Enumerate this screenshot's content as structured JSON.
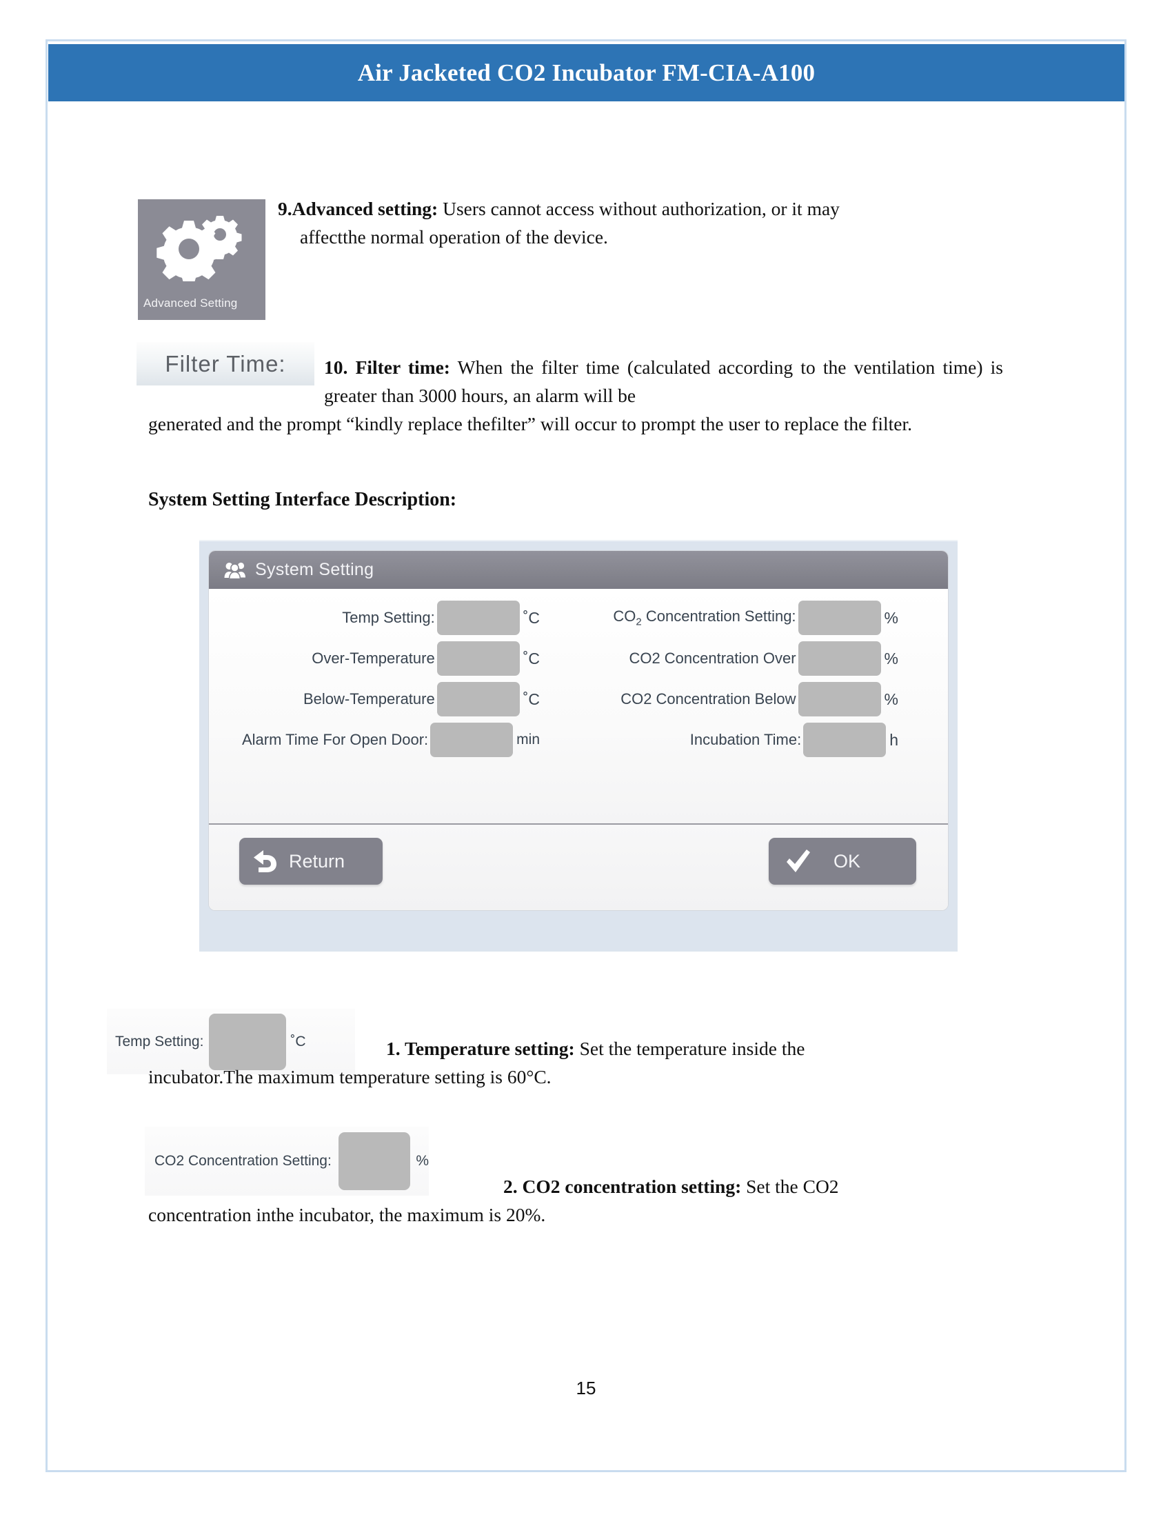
{
  "header": {
    "title": "Air Jacketed CO2 Incubator FM-CIA-A100"
  },
  "advanced_setting": {
    "icon_name": "gears-icon",
    "icon_caption": "Advanced Setting",
    "item_number": "9.",
    "item_title": "Advanced setting:",
    "text_line1": " Users cannot access without authorization, or it may",
    "text_line2": "affectthe normal operation of the device."
  },
  "filter_time": {
    "chip_label": "Filter Time:",
    "item_number": "10. ",
    "item_title": "Filter time:",
    "text_part1": " When the filter time (calculated according to the ventilation time) is greater than 3000 hours, an alarm will be",
    "text_part2": "generated and the prompt “kindly replace thefilter” will occur to prompt the user to replace the filter."
  },
  "section_heading": "System Setting Interface Description:",
  "dialog": {
    "title": "System Setting",
    "title_icon": "users-group-icon",
    "fields": [
      {
        "key": "temp_setting",
        "label": "Temp Setting:",
        "value": "",
        "unit": "˚C"
      },
      {
        "key": "over_temp",
        "label": "Over-Temperature",
        "value": "",
        "unit": "˚C"
      },
      {
        "key": "below_temp",
        "label": "Below-Temperature",
        "value": "",
        "unit": "˚C"
      },
      {
        "key": "alarm_time",
        "label": "Alarm Time For Open Door:",
        "value": "",
        "unit": "min"
      },
      {
        "key": "co2_setting",
        "label_html": "CO<sub>2</sub> Concentration Setting:",
        "label": "CO2 Concentration Setting:",
        "value": "",
        "unit": "%"
      },
      {
        "key": "co2_over",
        "label": "CO2 Concentration Over",
        "value": "",
        "unit": "%"
      },
      {
        "key": "co2_below",
        "label": "CO2 Concentration Below",
        "value": "",
        "unit": "%"
      },
      {
        "key": "incubation",
        "label": "Incubation Time:",
        "value": "",
        "unit": "h"
      }
    ],
    "buttons": {
      "return_label": "Return",
      "return_icon": "back-arrow-icon",
      "ok_label": "OK",
      "ok_icon": "checkmark-icon"
    }
  },
  "callout_temperature": {
    "label": "Temp Setting:",
    "value": "",
    "unit": "˚C",
    "item_number": "1. ",
    "item_title": "Temperature setting:",
    "text_part1": " Set the temperature inside the",
    "text_part2": "incubator.The maximum temperature setting is 60°C."
  },
  "callout_co2": {
    "label_plain": "CO2 Concentration Setting:",
    "value": "",
    "unit": "%",
    "item_number": "2. ",
    "item_title": "CO2 concentration setting:",
    "text_part1": " Set the CO2",
    "text_part2": "concentration inthe incubator, the maximum is 20%."
  },
  "footer": {
    "page_number": "15"
  },
  "colors": {
    "header_blue": "#2d74b5",
    "page_border": "#c9dcef",
    "icon_gray": "#8b8b95",
    "dialog_frame": "#dce4ee",
    "titlebar_gray": "#86868f",
    "input_gray": "#b9b9b9",
    "button_gray": "#82828c"
  }
}
